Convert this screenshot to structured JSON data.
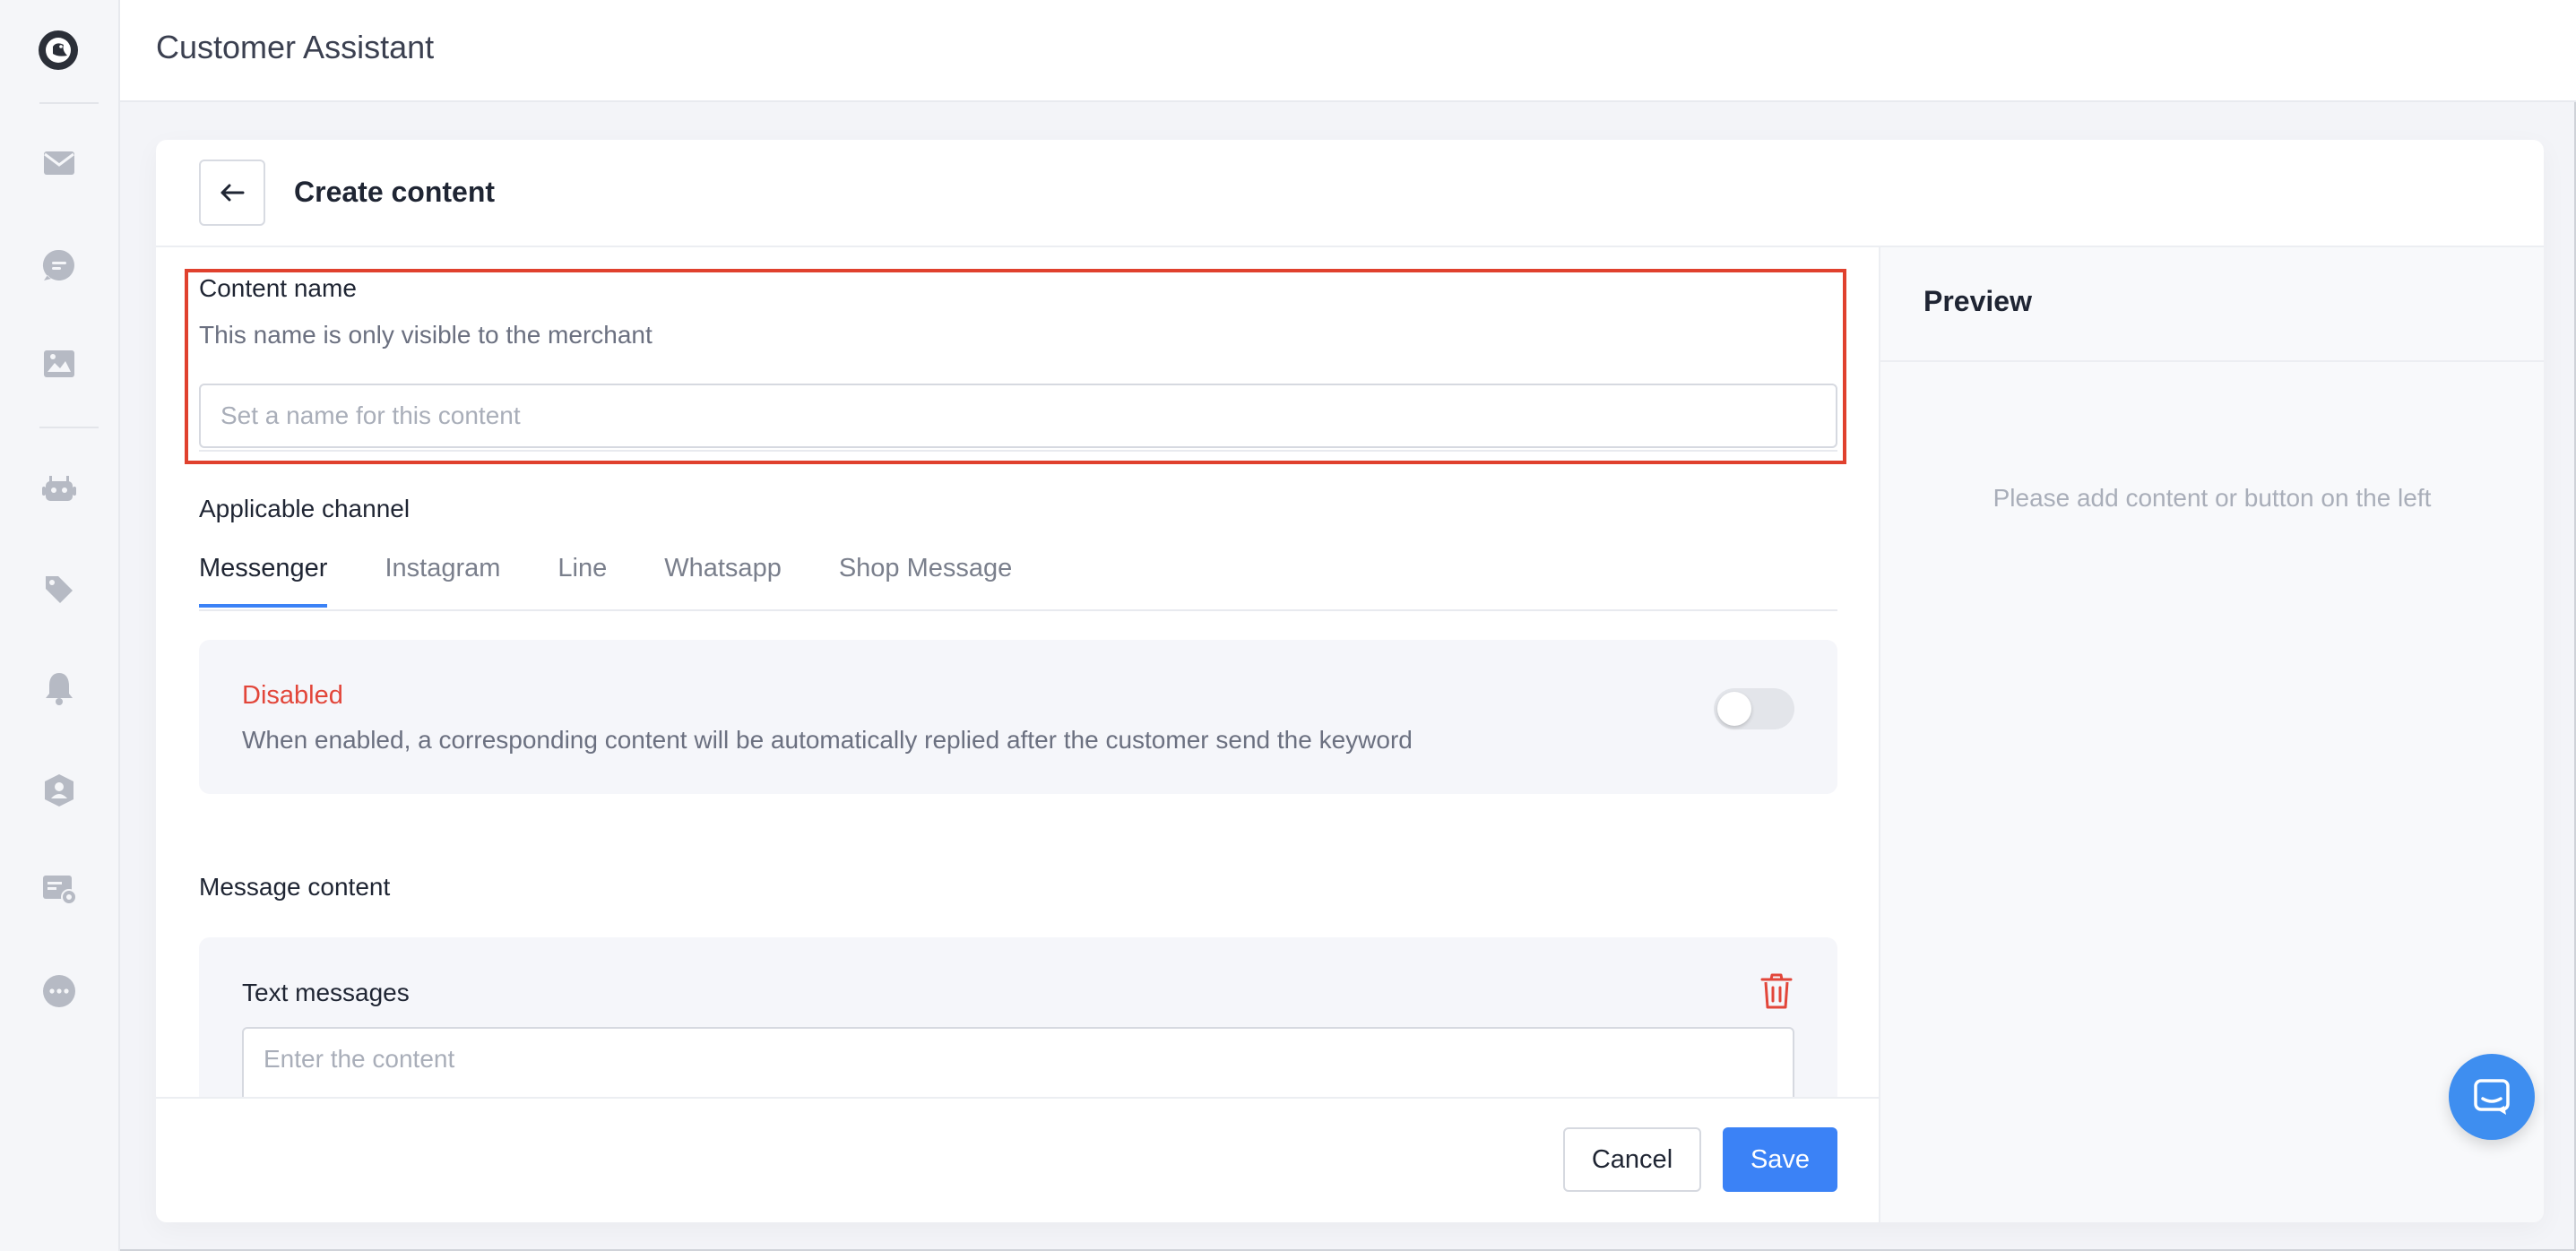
{
  "app": {
    "title": "Customer Assistant"
  },
  "sidebar": {
    "icons": [
      "logo-icon",
      "mail-icon",
      "chat-icon",
      "image-icon",
      "robot-icon",
      "tags-icon",
      "bell-icon",
      "user-shield-icon",
      "message-settings-icon",
      "more-icon"
    ]
  },
  "header": {
    "title": "Create content",
    "back_icon": "arrow-left-icon"
  },
  "content_name": {
    "label": "Content name",
    "hint": "This name is only visible to the merchant",
    "value": "",
    "placeholder": "Set a name for this content"
  },
  "channel": {
    "label": "Applicable channel",
    "tabs": [
      "Messenger",
      "Instagram",
      "Line",
      "Whatsapp",
      "Shop Message"
    ],
    "active": "Messenger"
  },
  "status": {
    "label": "Disabled",
    "description": "When enabled, a corresponding content will be automatically replied after the customer send the keyword",
    "enabled": false,
    "color": "#e2463a"
  },
  "message": {
    "label": "Message content",
    "block_label": "Text messages",
    "value": "",
    "placeholder": "Enter the content"
  },
  "footer": {
    "cancel_label": "Cancel",
    "save_label": "Save"
  },
  "preview": {
    "title": "Preview",
    "empty_text": "Please add content or button on the left"
  },
  "colors": {
    "accent": "#3b82f6",
    "danger": "#e2463a",
    "highlight": "#e0412e"
  }
}
